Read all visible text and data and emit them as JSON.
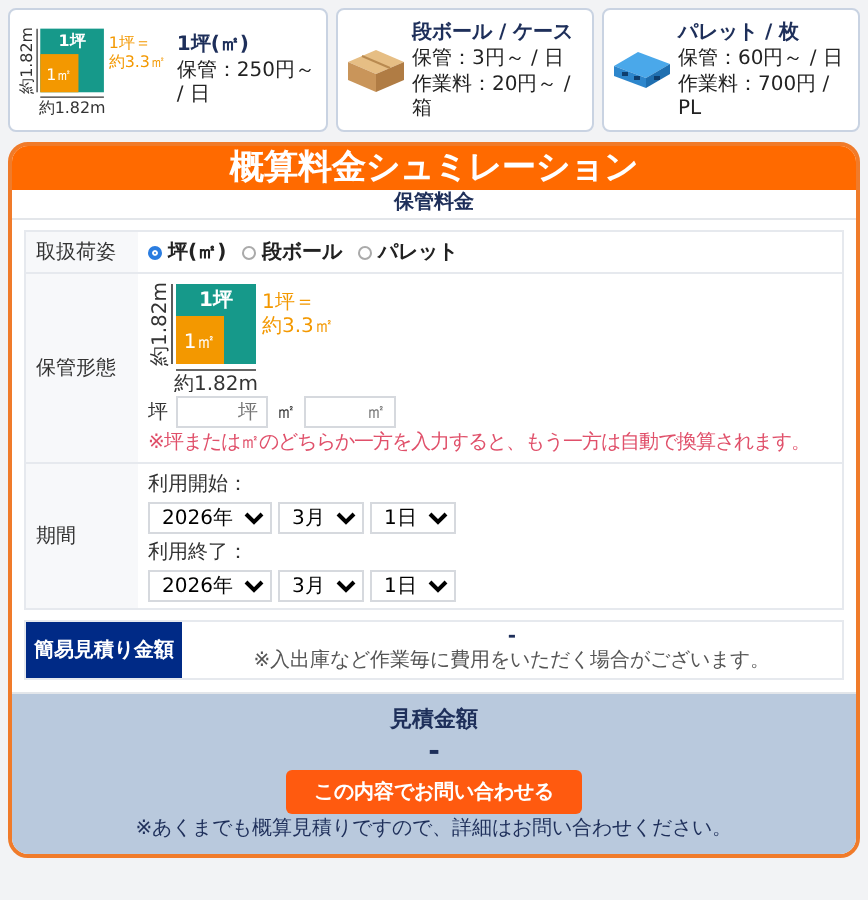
{
  "cards": [
    {
      "kind": "tsubo",
      "title": "1坪(㎡)",
      "lines": [
        "保管：250円～ / 日"
      ],
      "diagram": {
        "big": "1坪",
        "small": "1㎡",
        "equation": [
          "1坪＝",
          "約3.3㎡"
        ],
        "height": "約1.82m",
        "width": "約1.82m"
      }
    },
    {
      "kind": "box",
      "title": "段ボール / ケース",
      "lines": [
        "保管：3円～ / 日",
        "作業料：20円～ / 箱"
      ]
    },
    {
      "kind": "pallet",
      "title": "パレット / 枚",
      "lines": [
        "保管：60円～ / 日",
        "作業料：700円 / PL"
      ]
    }
  ],
  "simulator": {
    "title": "概算料金シュミレーション",
    "section": "保管料金",
    "rows": [
      {
        "kind": "radios",
        "label": "取扱荷姿",
        "options": [
          {
            "label": "坪(㎡)",
            "selected": true
          },
          {
            "label": "段ボール",
            "selected": false
          },
          {
            "label": "パレット",
            "selected": false
          }
        ]
      },
      {
        "kind": "area",
        "label": "保管形態",
        "diagram": {
          "big": "1坪",
          "small": "1㎡",
          "equation": [
            "1坪＝",
            "約3.3㎡"
          ],
          "height": "約1.82m",
          "width": "約1.82m"
        },
        "fields": [
          {
            "label": "坪",
            "placeholder": "坪"
          },
          {
            "label": "㎡",
            "placeholder": "㎡"
          }
        ],
        "note": "※坪または㎡のどちらか一方を入力すると、もう一方は自動で換算されます。"
      },
      {
        "kind": "period",
        "label": "期間",
        "groups": [
          {
            "label": "利用開始：",
            "selects": [
              "2026年",
              "3月",
              "1日"
            ]
          },
          {
            "label": "利用終了：",
            "selects": [
              "2026年",
              "3月",
              "1日"
            ]
          }
        ]
      }
    ],
    "estimate": {
      "label": "簡易見積り金額",
      "value": "-",
      "note": "※入出庫など作業毎に費用をいただく場合がございます。"
    }
  },
  "total": {
    "label": "見積金額",
    "value": "-",
    "button": "この内容でお問い合わせる",
    "note": "※あくまでも概算見積りですので、詳細はお問い合わせください。"
  }
}
